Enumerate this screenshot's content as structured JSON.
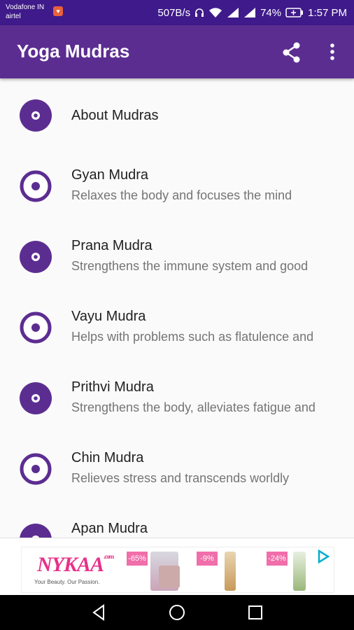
{
  "status_bar": {
    "carrier_1": "Vodafone IN",
    "carrier_2": "airtel",
    "speed": "507B/s",
    "battery": "74%",
    "time": "1:57 PM"
  },
  "app_bar": {
    "title": "Yoga Mudras",
    "share_icon": "share-icon",
    "more_icon": "more-vert-icon"
  },
  "list": [
    {
      "title": "About Mudras",
      "subtitle": "",
      "icon": "filled"
    },
    {
      "title": "Gyan Mudra",
      "subtitle": "Relaxes the body and focuses the mind",
      "icon": "outline"
    },
    {
      "title": "Prana Mudra",
      "subtitle": "Strengthens the immune system and good",
      "icon": "filled"
    },
    {
      "title": "Vayu Mudra",
      "subtitle": "Helps with problems such as flatulence and",
      "icon": "outline"
    },
    {
      "title": "Prithvi Mudra",
      "subtitle": "Strengthens the body, alleviates fatigue and",
      "icon": "filled"
    },
    {
      "title": "Chin Mudra",
      "subtitle": "Relieves stress and transcends worldly",
      "icon": "outline"
    },
    {
      "title": "Apan Mudra",
      "subtitle": "",
      "icon": "filled"
    }
  ],
  "ad": {
    "brand": "NYKAA",
    "brand_suffix": ".com",
    "tagline": "Your Beauty. Our Passion.",
    "discounts": [
      "-65%",
      "-9%",
      "-24%"
    ]
  },
  "colors": {
    "primary": "#5c2d91",
    "status_bar": "#3f1a8a",
    "accent_pink": "#e8308a"
  }
}
